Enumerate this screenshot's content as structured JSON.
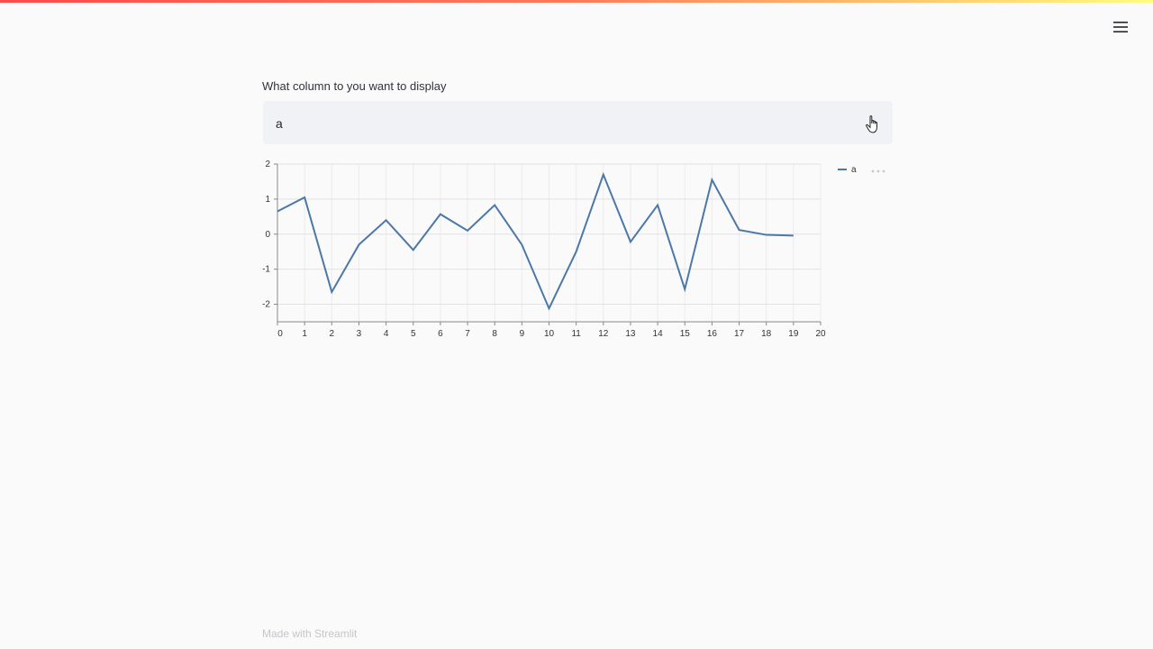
{
  "header": {
    "menu_icon": "hamburger-menu-icon"
  },
  "selectbox": {
    "label": "What column to you want to display",
    "value": "a",
    "cursor_icon": "pointer-hand-icon"
  },
  "chart_data": {
    "type": "line",
    "x": [
      0,
      1,
      2,
      3,
      4,
      5,
      6,
      7,
      8,
      9,
      10,
      11,
      12,
      13,
      14,
      15,
      16,
      17,
      18,
      19
    ],
    "series": [
      {
        "name": "a",
        "color": "#4c78a8",
        "values": [
          0.65,
          1.05,
          -1.65,
          -0.3,
          0.4,
          -0.45,
          0.57,
          0.1,
          0.83,
          -0.3,
          -2.12,
          -0.5,
          1.7,
          -0.22,
          0.83,
          -1.57,
          1.55,
          0.12,
          -0.02,
          -0.04
        ]
      }
    ],
    "xlim": [
      0,
      20
    ],
    "ylim": [
      -2.5,
      2
    ],
    "x_ticks": [
      "0",
      "1",
      "2",
      "3",
      "4",
      "5",
      "6",
      "7",
      "8",
      "9",
      "10",
      "11",
      "12",
      "13",
      "14",
      "15",
      "16",
      "17",
      "18",
      "19",
      "20"
    ],
    "y_ticks": [
      "2",
      "1",
      "0",
      "-1",
      "-2"
    ],
    "grid": true,
    "legend_position": "top-right",
    "actions_icon": "more-actions-icon"
  },
  "footer": {
    "text": "Made with Streamlit"
  }
}
